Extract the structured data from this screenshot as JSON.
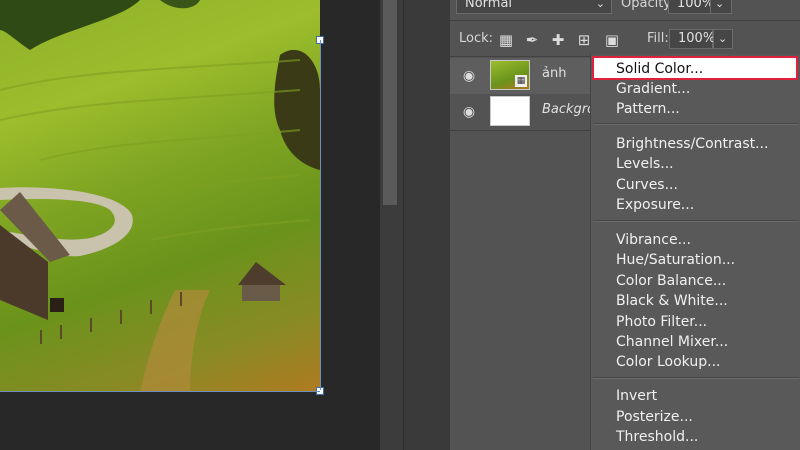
{
  "layers_panel": {
    "blend_mode": "Normal",
    "opacity_label": "Opacity:",
    "opacity_value": "100%",
    "lock_label": "Lock:",
    "fill_label": "Fill:",
    "fill_value": "100%",
    "layers": [
      {
        "name": "ảnh",
        "visible": true
      },
      {
        "name": "Background",
        "visible": true
      }
    ]
  },
  "adjustment_menu": {
    "items": [
      "Solid Color...",
      "Gradient...",
      "Pattern...",
      "Brightness/Contrast...",
      "Levels...",
      "Curves...",
      "Exposure...",
      "Vibrance...",
      "Hue/Saturation...",
      "Color Balance...",
      "Black & White...",
      "Photo Filter...",
      "Channel Mixer...",
      "Color Lookup...",
      "Invert",
      "Posterize...",
      "Threshold..."
    ],
    "highlighted": "Solid Color...",
    "highlight_color": "#e0203c"
  },
  "icons": [
    "eye-icon",
    "lock-transparent-icon",
    "brush-icon",
    "move-icon",
    "crop-icon",
    "lock-all-icon",
    "smart-object-icon",
    "dropdown-chevron-icon"
  ]
}
